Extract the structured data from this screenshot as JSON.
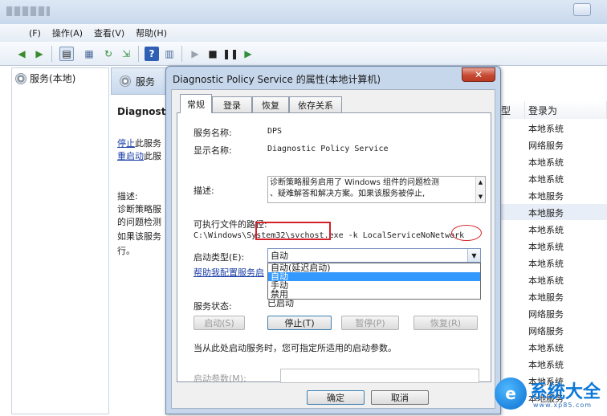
{
  "menubar": {
    "file_fragment": "(F)",
    "action": "操作(A)",
    "view": "查看(V)",
    "help": "帮助(H)"
  },
  "toolbar": {
    "icons": [
      "back-arrow-icon",
      "forward-arrow-icon",
      "console-tree-icon",
      "properties-icon",
      "refresh-icon",
      "export-icon",
      "help-icon",
      "view-icon",
      "play-icon",
      "stop-icon",
      "pause-icon",
      "resume-icon"
    ]
  },
  "tree": {
    "root_label": "服务(本地)"
  },
  "services_pane": {
    "header_label": "服务",
    "selected_title": "Diagnosti",
    "stop_link": "停止",
    "stop_suffix": "此服务",
    "restart_link": "重启动",
    "restart_suffix": "此服",
    "desc_label": "描述:",
    "desc_lines": [
      "诊断策略服",
      "的问题检测",
      "如果该服务",
      "行。"
    ]
  },
  "right_list": {
    "col_type_fragment": "型",
    "col_logon": "登录为",
    "rows": [
      "本地系统",
      "网络服务",
      "本地系统",
      "本地系统",
      "本地服务",
      "本地服务",
      "本地系统",
      "本地系统",
      "本地系统",
      "本地系统",
      "本地服务",
      "网络服务",
      "网络服务",
      "本地系统",
      "本地系统",
      "本地系统",
      "本地服务"
    ]
  },
  "dialog": {
    "title": "Diagnostic Policy Service 的属性(本地计算机)",
    "close_symbol": "✕",
    "tabs": [
      "常规",
      "登录",
      "恢复",
      "依存关系"
    ],
    "service_name_label": "服务名称:",
    "service_name": "DPS",
    "display_name_label": "显示名称:",
    "display_name": "Diagnostic Policy Service",
    "description_label": "描述:",
    "description_lines": [
      "诊断策略服务启用了 Windows 组件的问题检测",
      "、疑难解答和解决方案。如果该服务被停止,"
    ],
    "exe_path_label": "可执行文件的路径:",
    "exe_path": "C:\\Windows\\System32\\svchost.exe -k LocalServiceNoNetwork",
    "startup_type_label": "启动类型(E):",
    "startup_type_value": "自动",
    "startup_options": [
      "自动(延迟启动)",
      "自动",
      "手动",
      "禁用"
    ],
    "startup_selected_index": 1,
    "help_link": "帮助我配置服务启",
    "service_status_label": "服务状态:",
    "service_status_value": "已启动",
    "buttons": {
      "start": "启动(S)",
      "stop": "停止(T)",
      "pause": "暂停(P)",
      "resume": "恢复(R)"
    },
    "hint": "当从此处启动服务时，您可指定所适用的启动参数。",
    "params_label": "启动参数(M):",
    "ok": "确定",
    "cancel": "取消"
  },
  "watermark": {
    "brand": "系统大全",
    "url": "www.xp85.com"
  },
  "colors": {
    "annotation_red": "#d4222a",
    "link_blue": "#1a3ea6",
    "selection_blue": "#3399ff"
  }
}
